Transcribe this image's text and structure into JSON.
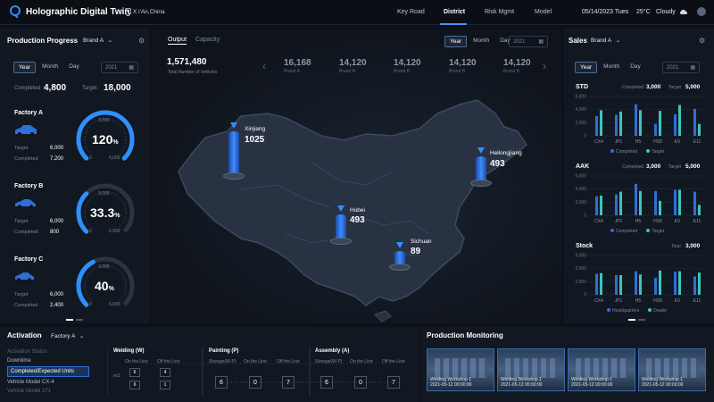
{
  "app": {
    "title": "Holographic Digital Twin",
    "location": "X i'An,China"
  },
  "nav": {
    "items": [
      "Key Road",
      "District",
      "Risk Mgmt",
      "Model"
    ],
    "active": "District"
  },
  "status": {
    "date": "05/14/2023 Tues",
    "temp": "25°C",
    "weather": "Cloudy"
  },
  "production": {
    "title": "Production Progress",
    "brand": "Brand A",
    "filters": [
      "Year",
      "Month",
      "Day"
    ],
    "date_placeholder": "2021",
    "completed_label": "Completed",
    "completed_value": "4,800",
    "target_label": "Target",
    "target_value": "18,000",
    "factories": [
      {
        "name": "Factory A",
        "target": "6,000",
        "completed": "7,200",
        "gauge_value": "120",
        "unit": "%",
        "gauge_top": "3,000",
        "gauge_left": "0",
        "gauge_right": "6,000",
        "progress": 1.0
      },
      {
        "name": "Factory B",
        "target": "6,000",
        "completed": "800",
        "gauge_value": "33.3",
        "unit": "%",
        "gauge_top": "3,000",
        "gauge_left": "0",
        "gauge_right": "6,000",
        "progress": 0.333
      },
      {
        "name": "Factory C",
        "target": "6,000",
        "completed": "2,400",
        "gauge_value": "40",
        "unit": "%",
        "gauge_top": "3,000",
        "gauge_left": "0",
        "gauge_right": "6,000",
        "progress": 0.4
      }
    ],
    "target_label_short": "Target",
    "completed_label_short": "Completed"
  },
  "center": {
    "tabs": [
      "Output",
      "Capacity"
    ],
    "filters": [
      "Year",
      "Month",
      "Day"
    ],
    "date_placeholder": "2021",
    "total_value": "1,571,480",
    "total_label": "Total Number of Vehicles",
    "brands": [
      {
        "value": "16,168",
        "label": "Brand A"
      },
      {
        "value": "14,120",
        "label": "Brand B"
      },
      {
        "value": "14,120",
        "label": "Brand B"
      },
      {
        "value": "14,120",
        "label": "Brand B"
      },
      {
        "value": "14,120",
        "label": "Brand B"
      }
    ],
    "markers": [
      {
        "name": "Xinjiang",
        "value": "1025"
      },
      {
        "name": "Heilongjiang",
        "value": "493"
      },
      {
        "name": "Hubei",
        "value": "493"
      },
      {
        "name": "Sichuan",
        "value": "89"
      }
    ]
  },
  "sales": {
    "title": "Sales",
    "brand": "Brand A",
    "filters": [
      "Year",
      "Month",
      "Day"
    ],
    "date_placeholder": "2021",
    "charts": [
      {
        "name": "STD",
        "stat1_label": "Completed",
        "stat1_value": "3,000",
        "stat2_label": "Target",
        "stat2_value": "5,000",
        "legend": [
          "Completed",
          "Target"
        ]
      },
      {
        "name": "AAK",
        "stat1_label": "Completed",
        "stat1_value": "3,000",
        "stat2_label": "Target",
        "stat2_value": "5,000",
        "legend": [
          "Completed",
          "Target"
        ]
      },
      {
        "name": "Stock",
        "stat1_label": "",
        "stat1_value": "",
        "stat2_label": "Total",
        "stat2_value": "3,000",
        "legend": [
          "Headquarters",
          "Dealer"
        ]
      }
    ]
  },
  "chart_data": [
    {
      "type": "bar",
      "title": "STD",
      "categories": [
        "CX4",
        "JP1",
        "H5",
        "HS5",
        "EV",
        "E11"
      ],
      "ylim": [
        0,
        6000
      ],
      "yticks": [
        "6,000",
        "4,000",
        "2,000",
        "0"
      ],
      "series": [
        {
          "name": "Completed",
          "color": "#2f6fd6",
          "values": [
            3000,
            3200,
            4800,
            1800,
            3300,
            4100
          ]
        },
        {
          "name": "Target",
          "color": "#3ec5b8",
          "values": [
            3900,
            3700,
            3900,
            3800,
            4700,
            1800
          ]
        }
      ]
    },
    {
      "type": "bar",
      "title": "AAK",
      "categories": [
        "CX4",
        "JP1",
        "H5",
        "HS5",
        "EV",
        "E11"
      ],
      "ylim": [
        0,
        6000
      ],
      "yticks": [
        "6,000",
        "4,000",
        "2,000",
        "0"
      ],
      "series": [
        {
          "name": "Completed",
          "color": "#2f6fd6",
          "values": [
            2900,
            3200,
            4800,
            3700,
            3900,
            3600
          ]
        },
        {
          "name": "Target",
          "color": "#3ec5b8",
          "values": [
            3000,
            3600,
            3700,
            2200,
            3900,
            1600
          ]
        }
      ]
    },
    {
      "type": "bar",
      "title": "Stock",
      "categories": [
        "CX4",
        "JP1",
        "H5",
        "HS5",
        "EV",
        "E11"
      ],
      "ylim": [
        0,
        6000
      ],
      "yticks": [
        "4,000",
        "2,000",
        "2,000",
        "0"
      ],
      "series": [
        {
          "name": "Headquarters",
          "color": "#2f6fd6",
          "values": [
            3200,
            3000,
            3600,
            2600,
            3500,
            2800
          ]
        },
        {
          "name": "Dealer",
          "color": "#3ec5b8",
          "values": [
            3300,
            3000,
            3100,
            3700,
            3600,
            3400
          ]
        }
      ]
    }
  ],
  "activation": {
    "title": "Activation",
    "factory": "Factory A",
    "status_items": [
      "Activation Status",
      "Downtime",
      "Completed/Expected Units",
      "Vehicle Model CX-4",
      "Vehicle Model 271"
    ],
    "active_item": "Completed/Expected Units",
    "stages": [
      {
        "title": "Welding (W)",
        "cols": [
          "On the Line",
          "Off the Line"
        ],
        "row_label": "ec1"
      },
      {
        "title": "Painting (P)",
        "cols": [
          "Storage(W-P)",
          "On the Line",
          "Off the Line"
        ],
        "values": [
          "6",
          "0",
          "7"
        ]
      },
      {
        "title": "Assembly (A)",
        "cols": [
          "Storage(W-P)",
          "On the Line",
          "Off the Line"
        ],
        "values": [
          "6",
          "0",
          "7"
        ]
      }
    ],
    "welding_values": [
      "6",
      "4",
      "6",
      "1"
    ]
  },
  "monitoring": {
    "title": "Production Monitoring",
    "cams": [
      {
        "label": "Welding Workshop 1",
        "time": "2021-05-12 00:00:00"
      },
      {
        "label": "Welding Workshop 1",
        "time": "2021-05-12 00:00:00"
      },
      {
        "label": "Welding Workshop 1",
        "time": "2021-05-12 00:00:00"
      },
      {
        "label": "Welding Workshop 1",
        "time": "2021-05-12 00:00:00"
      }
    ]
  },
  "colors": {
    "accent": "#2f6fd6",
    "teal": "#3ec5b8",
    "bg": "#0d1118"
  }
}
